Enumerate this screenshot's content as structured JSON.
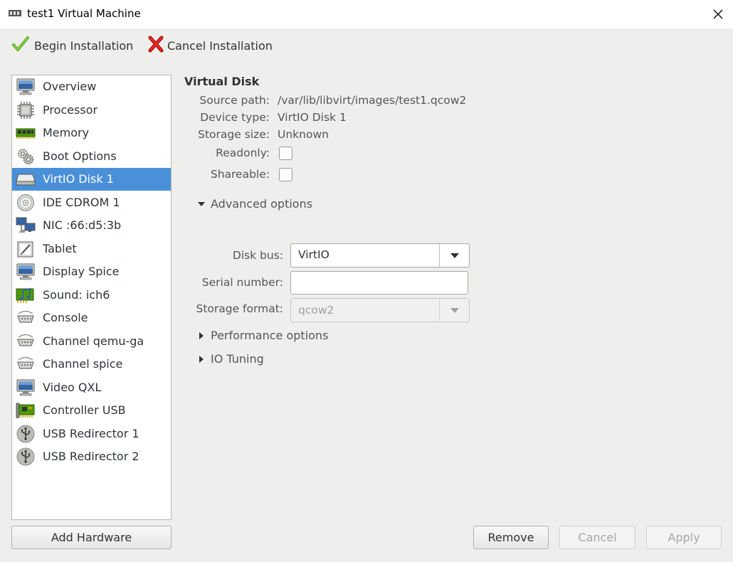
{
  "window": {
    "title": "test1 Virtual Machine"
  },
  "toolbar": {
    "begin_label": "Begin Installation",
    "cancel_label": "Cancel Installation"
  },
  "sidebar": {
    "selected_index": 4,
    "items": [
      {
        "label": "Overview",
        "icon": "monitor-icon"
      },
      {
        "label": "Processor",
        "icon": "cpu-chip-icon"
      },
      {
        "label": "Memory",
        "icon": "ram-module-icon"
      },
      {
        "label": "Boot Options",
        "icon": "gears-icon"
      },
      {
        "label": "VirtIO Disk 1",
        "icon": "hard-disk-icon"
      },
      {
        "label": "IDE CDROM 1",
        "icon": "cdrom-icon"
      },
      {
        "label": "NIC :66:d5:3b",
        "icon": "network-icon"
      },
      {
        "label": "Tablet",
        "icon": "tablet-icon"
      },
      {
        "label": "Display Spice",
        "icon": "monitor-icon"
      },
      {
        "label": "Sound: ich6",
        "icon": "sound-card-icon"
      },
      {
        "label": "Console",
        "icon": "serial-port-icon"
      },
      {
        "label": "Channel qemu-ga",
        "icon": "serial-port-icon"
      },
      {
        "label": "Channel spice",
        "icon": "serial-port-icon"
      },
      {
        "label": "Video QXL",
        "icon": "monitor-icon"
      },
      {
        "label": "Controller USB",
        "icon": "pci-card-icon"
      },
      {
        "label": "USB Redirector 1",
        "icon": "usb-icon"
      },
      {
        "label": "USB Redirector 2",
        "icon": "usb-icon"
      }
    ]
  },
  "disk": {
    "section_title": "Virtual Disk",
    "source_path_label": "Source path:",
    "source_path": "/var/lib/libvirt/images/test1.qcow2",
    "device_type_label": "Device type:",
    "device_type": "VirtIO Disk 1",
    "storage_size_label": "Storage size:",
    "storage_size": "Unknown",
    "readonly_label": "Readonly:",
    "readonly": false,
    "shareable_label": "Shareable:",
    "shareable": false
  },
  "advanced": {
    "label": "Advanced options",
    "expanded": true,
    "disk_bus_label": "Disk bus:",
    "disk_bus": "VirtIO",
    "serial_label": "Serial number:",
    "serial_value": "",
    "storage_format_label": "Storage format:",
    "storage_format": "qcow2"
  },
  "performance": {
    "label": "Performance options",
    "expanded": false
  },
  "io_tuning": {
    "label": "IO Tuning",
    "expanded": false
  },
  "buttons": {
    "add_hardware": "Add Hardware",
    "remove": "Remove",
    "cancel": "Cancel",
    "apply": "Apply"
  },
  "colors": {
    "selection": "#4a90d9",
    "background": "#eeeeec"
  }
}
